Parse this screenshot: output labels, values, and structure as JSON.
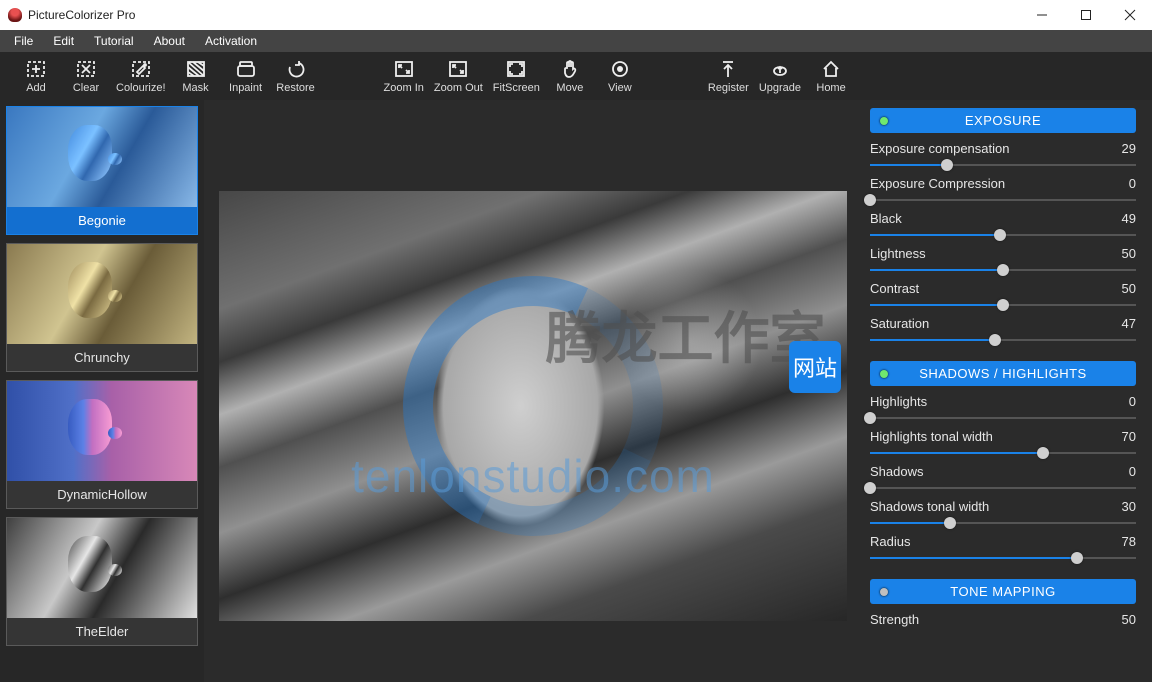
{
  "window": {
    "title": "PictureColorizer Pro"
  },
  "menu": [
    "File",
    "Edit",
    "Tutorial",
    "About",
    "Activation"
  ],
  "toolbar": [
    {
      "id": "add",
      "label": "Add"
    },
    {
      "id": "clear",
      "label": "Clear"
    },
    {
      "id": "colourize",
      "label": "Colourize!"
    },
    {
      "id": "mask",
      "label": "Mask"
    },
    {
      "id": "inpaint",
      "label": "Inpaint"
    },
    {
      "id": "restore",
      "label": "Restore"
    },
    {
      "id": "gap1",
      "label": ""
    },
    {
      "id": "zoomin",
      "label": "Zoom In"
    },
    {
      "id": "zoomout",
      "label": "Zoom Out"
    },
    {
      "id": "fitscreen",
      "label": "FitScreen"
    },
    {
      "id": "move",
      "label": "Move"
    },
    {
      "id": "view",
      "label": "View"
    },
    {
      "id": "gap2",
      "label": ""
    },
    {
      "id": "register",
      "label": "Register"
    },
    {
      "id": "upgrade",
      "label": "Upgrade"
    },
    {
      "id": "home",
      "label": "Home"
    }
  ],
  "presets": [
    {
      "name": "Begonie",
      "selected": true,
      "style": "blue"
    },
    {
      "name": "Chrunchy",
      "selected": false,
      "style": "sepia"
    },
    {
      "name": "DynamicHollow",
      "selected": false,
      "style": "duo"
    },
    {
      "name": "TheElder",
      "selected": false,
      "style": "mono"
    }
  ],
  "watermark": {
    "cj": "腾龙工作室",
    "url": "tenlonstudio.com",
    "stamp": "网站"
  },
  "panels": {
    "exposure": {
      "title": "EXPOSURE",
      "sliders": [
        {
          "label": "Exposure compensation",
          "value": 29,
          "pct": 29
        },
        {
          "label": "Exposure Compression",
          "value": 0,
          "pct": 0
        },
        {
          "label": "Black",
          "value": 49,
          "pct": 49
        },
        {
          "label": "Lightness",
          "value": 50,
          "pct": 50
        },
        {
          "label": "Contrast",
          "value": 50,
          "pct": 50
        },
        {
          "label": "Saturation",
          "value": 47,
          "pct": 47
        }
      ]
    },
    "shadows": {
      "title": "SHADOWS / HIGHLIGHTS",
      "sliders": [
        {
          "label": "Highlights",
          "value": 0,
          "pct": 0
        },
        {
          "label": "Highlights tonal width",
          "value": 70,
          "pct": 65
        },
        {
          "label": "Shadows",
          "value": 0,
          "pct": 0
        },
        {
          "label": "Shadows tonal width",
          "value": 30,
          "pct": 30
        },
        {
          "label": "Radius",
          "value": 78,
          "pct": 78
        }
      ]
    },
    "tonemapping": {
      "title": "TONE MAPPING",
      "sliders": [
        {
          "label": "Strength",
          "value": 50,
          "pct": 50
        }
      ]
    }
  }
}
